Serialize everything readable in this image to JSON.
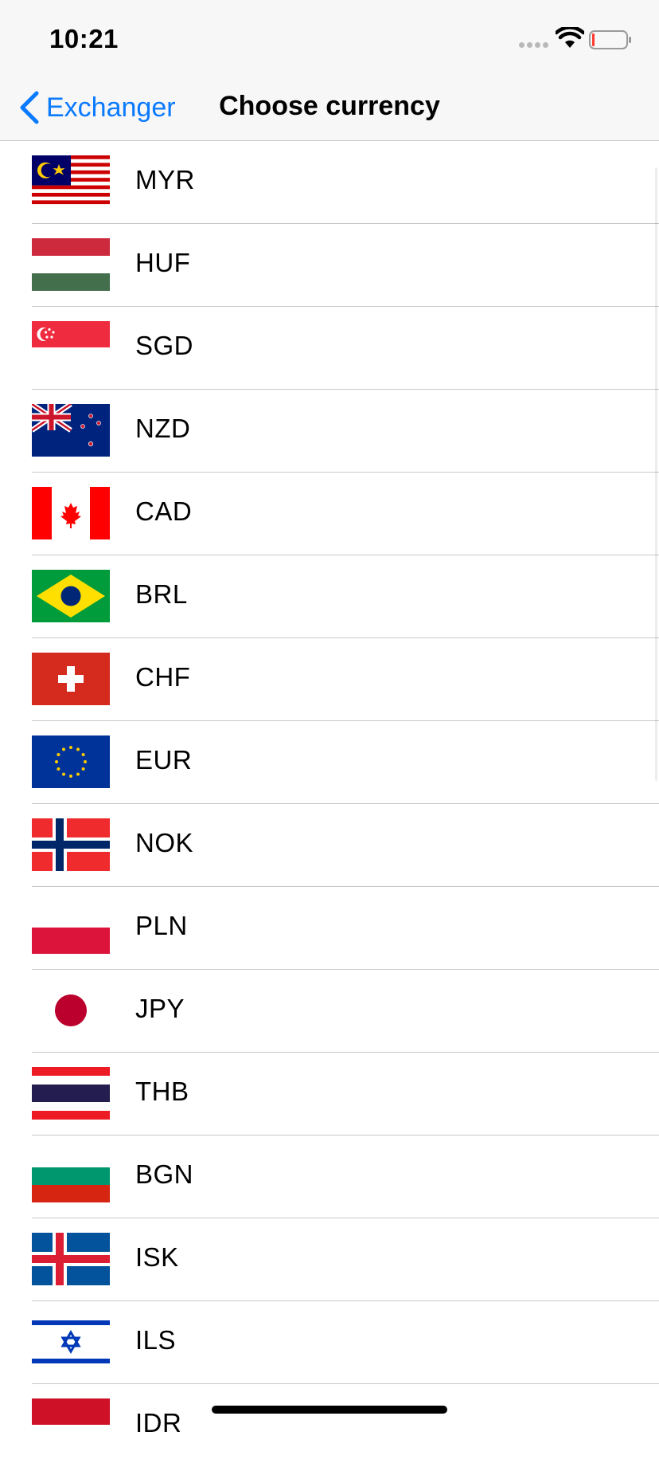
{
  "status_bar": {
    "time": "10:21"
  },
  "nav": {
    "back_label": "Exchanger",
    "title": "Choose currency"
  },
  "currencies": [
    {
      "code": "MYR",
      "flag_icon": "malaysia-flag-icon"
    },
    {
      "code": "HUF",
      "flag_icon": "hungary-flag-icon"
    },
    {
      "code": "SGD",
      "flag_icon": "singapore-flag-icon"
    },
    {
      "code": "NZD",
      "flag_icon": "new-zealand-flag-icon"
    },
    {
      "code": "CAD",
      "flag_icon": "canada-flag-icon"
    },
    {
      "code": "BRL",
      "flag_icon": "brazil-flag-icon"
    },
    {
      "code": "CHF",
      "flag_icon": "switzerland-flag-icon"
    },
    {
      "code": "EUR",
      "flag_icon": "eu-flag-icon"
    },
    {
      "code": "NOK",
      "flag_icon": "norway-flag-icon"
    },
    {
      "code": "PLN",
      "flag_icon": "poland-flag-icon"
    },
    {
      "code": "JPY",
      "flag_icon": "japan-flag-icon"
    },
    {
      "code": "THB",
      "flag_icon": "thailand-flag-icon"
    },
    {
      "code": "BGN",
      "flag_icon": "bulgaria-flag-icon"
    },
    {
      "code": "ISK",
      "flag_icon": "iceland-flag-icon"
    },
    {
      "code": "ILS",
      "flag_icon": "israel-flag-icon"
    },
    {
      "code": "IDR",
      "flag_icon": "indonesia-flag-icon"
    }
  ],
  "colors": {
    "accent": "#0a7aff",
    "separator": "#c8c8cc",
    "bar_background": "#f7f7f7"
  }
}
